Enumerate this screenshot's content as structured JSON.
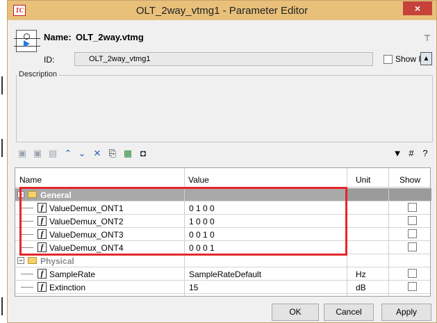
{
  "window": {
    "app_icon": "TC",
    "title": "OLT_2way_vtmg1 - Parameter Editor",
    "close_glyph": "×"
  },
  "header": {
    "name_label": "Name:",
    "name_value": "OLT_2way.vtmg",
    "id_label": "ID:",
    "id_value": "OLT_2way_vtmg1",
    "show_id_label": "Show ID"
  },
  "description": {
    "legend": "Description",
    "text": ""
  },
  "toolbar": {
    "icons": [
      "add-icon",
      "add-copy-icon",
      "save-defaults-icon",
      "move-up-icon",
      "move-down-icon",
      "delete-icon",
      "import-icon",
      "export-icon",
      "save-icon",
      "filter-icon",
      "grid-icon",
      "help-icon"
    ]
  },
  "grid": {
    "columns": [
      "Name",
      "Value",
      "Unit",
      "Show"
    ],
    "rows": [
      {
        "type": "group",
        "label": "General",
        "expanded": true
      },
      {
        "type": "param",
        "name": "ValueDemux_ONT1",
        "value": "0 1 0 0",
        "unit": "",
        "show": false
      },
      {
        "type": "param",
        "name": "ValueDemux_ONT2",
        "value": "1 0 0 0",
        "unit": "",
        "show": false
      },
      {
        "type": "param",
        "name": "ValueDemux_ONT3",
        "value": "0 0 1 0",
        "unit": "",
        "show": false
      },
      {
        "type": "param",
        "name": "ValueDemux_ONT4",
        "value": "0 0 0 1",
        "unit": "",
        "show": false
      },
      {
        "type": "group",
        "label": "Physical",
        "expanded": true
      },
      {
        "type": "param",
        "name": "SampleRate",
        "value": "SampleRateDefault",
        "unit": "Hz",
        "show": false
      },
      {
        "type": "param",
        "name": "Extinction",
        "value": "15",
        "unit": "dB",
        "show": false
      }
    ]
  },
  "buttons": {
    "ok": "OK",
    "cancel": "Cancel",
    "apply": "Apply"
  },
  "colors": {
    "titlebar": "#e8c07a",
    "close": "#c7423a",
    "highlight": "#e4262b",
    "group_general": "#a9a9a9"
  }
}
